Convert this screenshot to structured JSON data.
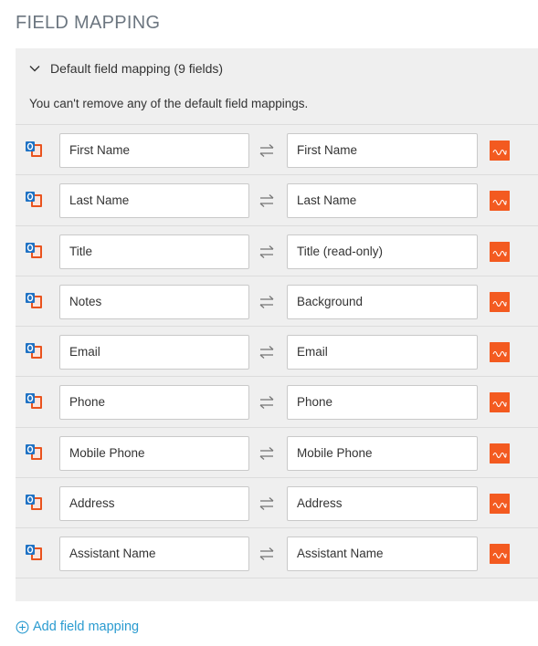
{
  "heading": "FIELD MAPPING",
  "panel": {
    "title": "Default field mapping (9 fields)",
    "note": "You can't remove any of the default field mappings.",
    "expanded": true
  },
  "mappings": [
    {
      "source": "First Name",
      "target": "First Name"
    },
    {
      "source": "Last Name",
      "target": "Last Name"
    },
    {
      "source": "Title",
      "target": "Title (read-only)"
    },
    {
      "source": "Notes",
      "target": "Background"
    },
    {
      "source": "Email",
      "target": "Email"
    },
    {
      "source": "Phone",
      "target": "Phone"
    },
    {
      "source": "Mobile Phone",
      "target": "Mobile Phone"
    },
    {
      "source": "Address",
      "target": "Address"
    },
    {
      "source": "Assistant Name",
      "target": "Assistant Name"
    }
  ],
  "icons": {
    "source": "outlook-icon",
    "swap": "swap-arrows-icon",
    "target": "insightly-icon",
    "toggle": "chevron-down-icon",
    "add": "plus-circle-icon"
  },
  "colors": {
    "link": "#2a9bd0",
    "panel_bg": "#efefef",
    "target_icon": "#f35a20",
    "outlook_blue": "#1f72c4",
    "outlook_orange": "#e9531e"
  },
  "add_link": "Add field mapping"
}
